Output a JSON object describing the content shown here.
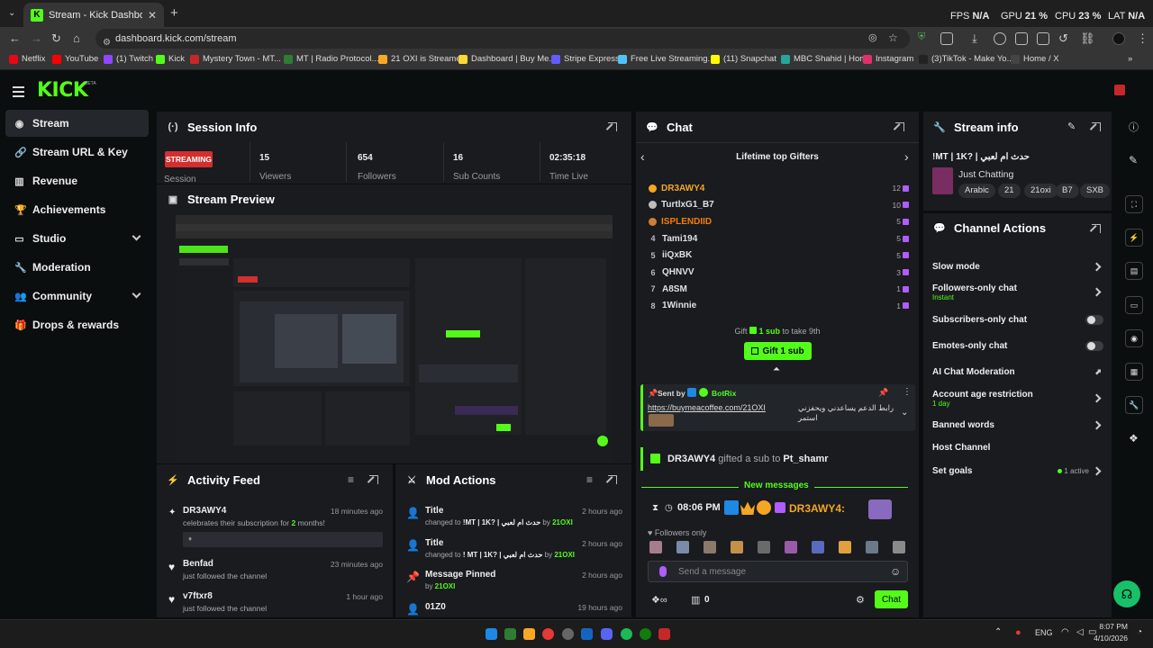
{
  "browser": {
    "tab_title": "Stream - Kick Dashboard",
    "url": "dashboard.kick.com/stream",
    "stats": {
      "fps_label": "FPS",
      "fps_value": "N/A",
      "gpu_label": "GPU",
      "gpu_value": "21 %",
      "cpu_label": "CPU",
      "cpu_value": "23 %",
      "lat_label": "LAT",
      "lat_value": "N/A"
    },
    "bookmarks": [
      {
        "label": "Netflix",
        "color": "#e50914"
      },
      {
        "label": "YouTube",
        "color": "#ff0000"
      },
      {
        "label": "(1) Twitch",
        "color": "#9146ff"
      },
      {
        "label": "Kick",
        "color": "#53fc18"
      },
      {
        "label": "Mystery Town - MT...",
        "color": "#c62828"
      },
      {
        "label": "MT | Radio Protocol...",
        "color": "#2e7d32"
      },
      {
        "label": "21 OXI is Streamer",
        "color": "#f9a825"
      },
      {
        "label": "Dashboard | Buy Me...",
        "color": "#fdd835"
      },
      {
        "label": "Stripe Express",
        "color": "#635bff"
      },
      {
        "label": "Free Live Streaming...",
        "color": "#4fc3f7"
      },
      {
        "label": "(11) Snapchat",
        "color": "#fffc00"
      },
      {
        "label": "MBC Shahid | Home",
        "color": "#26a69a"
      },
      {
        "label": "Instagram",
        "color": "#e1306c"
      },
      {
        "label": "(3)TikTok - Make Yo...",
        "color": "#222222"
      },
      {
        "label": "Home / X",
        "color": "#444444"
      }
    ]
  },
  "app": {
    "logo": "KICK",
    "logo_badge": "BETA",
    "brand_color": "#53fc18"
  },
  "sidebar": {
    "items": [
      {
        "label": "Stream",
        "icon": "broadcast-icon"
      },
      {
        "label": "Stream URL & Key",
        "icon": "link-icon"
      },
      {
        "label": "Revenue",
        "icon": "chart-icon"
      },
      {
        "label": "Achievements",
        "icon": "trophy-icon"
      },
      {
        "label": "Studio",
        "icon": "tv-icon"
      },
      {
        "label": "Moderation",
        "icon": "wrench-icon"
      },
      {
        "label": "Community",
        "icon": "people-icon"
      },
      {
        "label": "Drops & rewards",
        "icon": "gift-icon"
      }
    ]
  },
  "session": {
    "title": "Session Info",
    "status": "STREAMING",
    "status_label": "Session",
    "stats": [
      {
        "value": "15",
        "label": "Viewers"
      },
      {
        "value": "654",
        "label": "Followers"
      },
      {
        "value": "16",
        "label": "Sub Counts"
      },
      {
        "value": "02:35:18",
        "label": "Time Live"
      }
    ]
  },
  "preview": {
    "title": "Stream Preview"
  },
  "activity": {
    "title": "Activity Feed",
    "items": [
      {
        "name": "DR3AWY4",
        "text_pre": "celebrates their subscription for ",
        "highlight": "2",
        "text_post": " months!",
        "time": "18 minutes ago"
      },
      {
        "name": "Benfad",
        "text": "just followed the channel",
        "time": "23 minutes ago"
      },
      {
        "name": "v7ftxr8",
        "text": "just followed the channel",
        "time": "1 hour ago"
      }
    ]
  },
  "mod": {
    "title": "Mod Actions",
    "items": [
      {
        "title": "Title",
        "pre": "changed to ",
        "value": "!MT | 1K? | حدث ام لعبي",
        "by": " by ",
        "user": "21OXI",
        "time": "2 hours ago"
      },
      {
        "title": "Title",
        "pre": "changed to ",
        "value": "! MT | 1K? | حدث ام لعبي",
        "by": " by ",
        "user": "21OXI",
        "time": "2 hours ago"
      },
      {
        "title": "Message Pinned",
        "pre": "by ",
        "user": "21OXI",
        "time": "2 hours ago"
      },
      {
        "title": "01Z0",
        "time": "19 hours ago"
      }
    ]
  },
  "chat": {
    "title": "Chat",
    "gifters_title": "Lifetime top Gifters",
    "gifters": [
      {
        "rank": "",
        "name": "DR3AWY4",
        "count": "12",
        "color": "#f5a623"
      },
      {
        "rank": "",
        "name": "TurtlxG1_B7",
        "count": "10",
        "color": "#e0e0e0"
      },
      {
        "rank": "",
        "name": "ISPLENDIID",
        "count": "5",
        "color": "#f57c00"
      },
      {
        "rank": "4",
        "name": "Tami194",
        "count": "5",
        "color": "#e0e0e0"
      },
      {
        "rank": "5",
        "name": "iiQxBK",
        "count": "5",
        "color": "#e0e0e0"
      },
      {
        "rank": "6",
        "name": "QHNVV",
        "count": "3",
        "color": "#e0e0e0"
      },
      {
        "rank": "7",
        "name": "A8SM",
        "count": "1",
        "color": "#e0e0e0"
      },
      {
        "rank": "8",
        "name": "1Winnie",
        "count": "1",
        "color": "#e0e0e0"
      }
    ],
    "gift_hint_pre": "Gift",
    "gift_hint_sub": "1 sub",
    "gift_hint_post": "to take 9th",
    "gift_button": "Gift 1 sub",
    "pinned_sent_by": "Sent by",
    "pinned_user": "BotRix",
    "pinned_link": "https://buymeacoffee.com/21OXI",
    "pinned_text": "رابط الدعم يساعدني ويحفزني استمر",
    "gift_event_user": "DR3AWY4",
    "gift_event_text": "gifted a sub to",
    "gift_event_target": "Pt_shamr",
    "new_messages": "New messages",
    "msg_time": "08:06 PM",
    "msg_user": "DR3AWY4:",
    "followers_only": "Followers only",
    "placeholder": "Send a message",
    "points": "0",
    "chat_button": "Chat"
  },
  "stream_info": {
    "title": "Stream info",
    "stream_title": "!MT | 1K? | حدث ام لعبي",
    "category": "Just Chatting",
    "tags": [
      "Arabic",
      "21",
      "21oxi",
      "B7",
      "SXB"
    ]
  },
  "channel_actions": {
    "title": "Channel Actions",
    "items": [
      {
        "label": "Slow mode",
        "control": "chevron"
      },
      {
        "label": "Followers-only chat",
        "sub": "Instant",
        "control": "chevron"
      },
      {
        "label": "Subscribers-only chat",
        "control": "toggle"
      },
      {
        "label": "Emotes-only chat",
        "control": "toggle"
      },
      {
        "label": "AI Chat Moderation",
        "control": "external"
      },
      {
        "label": "Account age restriction",
        "sub": "1 day",
        "control": "chevron"
      },
      {
        "label": "Banned words",
        "control": "chevron"
      },
      {
        "label": "Host Channel",
        "control": "none"
      },
      {
        "label": "Set goals",
        "badge": "1 active",
        "control": "chevron"
      }
    ]
  },
  "taskbar": {
    "lang": "ENG",
    "time": "8:07 PM",
    "date": "4/10/2026"
  }
}
